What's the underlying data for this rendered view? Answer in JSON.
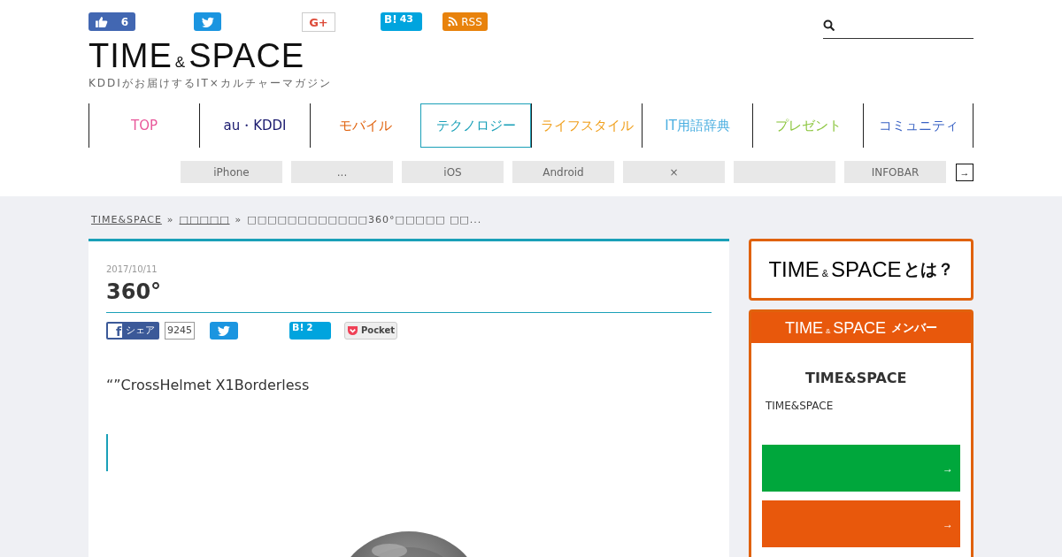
{
  "header": {
    "logo": [
      "TIME",
      "&",
      "SPACE"
    ],
    "tagline": "KDDIがお届けするIT×カルチャーマガジン",
    "social": [
      {
        "kind": "like",
        "count": "6"
      },
      {
        "kind": "twitter"
      },
      {
        "kind": "gplus",
        "label": "G+"
      },
      {
        "kind": "hatena",
        "label": "B!",
        "count": "43"
      },
      {
        "kind": "rss",
        "label": "RSS"
      }
    ],
    "has_search": true
  },
  "nav": [
    {
      "label": "TOP",
      "color": "#e8579a",
      "selected": false
    },
    {
      "label": "au・KDDI",
      "color": "#1a1a6e",
      "selected": false
    },
    {
      "label": "モバイル",
      "color": "#e0620d",
      "selected": false
    },
    {
      "label": "テクノロジー",
      "color": "#1aa0b8",
      "selected": true
    },
    {
      "label": "ライフスタイル",
      "color": "#f0a01e",
      "selected": false
    },
    {
      "label": "IT用語辞典",
      "color": "#4aaee0",
      "selected": false
    },
    {
      "label": "プレゼント",
      "color": "#8cc63e",
      "selected": false
    },
    {
      "label": "コミュニティ",
      "color": "#3a63c4",
      "selected": false
    }
  ],
  "tags": [
    {
      "kind": "text",
      "label": "iPhone"
    },
    {
      "kind": "text",
      "label": "..."
    },
    {
      "kind": "text",
      "label": "iOS"
    },
    {
      "kind": "text",
      "label": "Android"
    },
    {
      "kind": "text",
      "label": "×"
    },
    {
      "kind": "blank"
    },
    {
      "kind": "text",
      "label": "INFOBAR"
    }
  ],
  "tags_more": "→",
  "breadcrumb": [
    {
      "label": "TIME&SPACE",
      "link": true,
      "sep": "»"
    },
    {
      "label": "□□□□□",
      "link": true,
      "sep": "»"
    },
    {
      "label": "□□□□□□□□□□□□360°□□□□□ □□...",
      "link": false
    }
  ],
  "article": {
    "date": "2017/10/11",
    "title": "360°",
    "share": [
      {
        "kind": "facebook",
        "icon": "f",
        "label": "シェア",
        "count": "9245"
      },
      {
        "kind": "twitter"
      },
      {
        "kind": "hatena",
        "label": "B!",
        "count": "2"
      },
      {
        "kind": "pocket",
        "label": "Pocket"
      }
    ],
    "body": "“”CrossHelmet X1Borderless",
    "has_quote": true
  },
  "sidebar": {
    "about": {
      "logo": [
        "TIME",
        "&",
        "SPACE"
      ],
      "suffix": "とは？"
    },
    "members": {
      "logo": [
        "TIME",
        "&",
        "SPACE"
      ],
      "suffix": "メンバー",
      "name": "TIME&SPACE",
      "text": "TIME&SPACE",
      "buttons": [
        {
          "color": "#00a73c",
          "arrow": "→"
        },
        {
          "color": "#e8580c",
          "arrow": "→"
        }
      ]
    }
  }
}
